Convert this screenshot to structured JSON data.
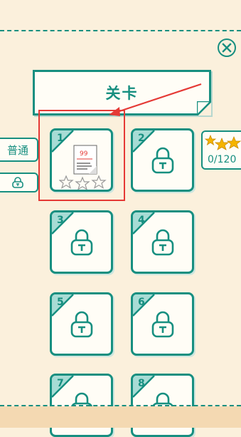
{
  "header": {
    "title": "关卡"
  },
  "tabs": [
    {
      "label": "普通",
      "active": true
    },
    {
      "label": "",
      "locked": true
    }
  ],
  "stars_counter": {
    "value": "0/120"
  },
  "levels": [
    {
      "number": "1",
      "locked": false,
      "best_score": "99",
      "stars": 0
    },
    {
      "number": "2",
      "locked": true
    },
    {
      "number": "3",
      "locked": true
    },
    {
      "number": "4",
      "locked": true
    },
    {
      "number": "5",
      "locked": true
    },
    {
      "number": "6",
      "locked": true
    },
    {
      "number": "7",
      "locked": true
    },
    {
      "number": "8",
      "locked": true
    }
  ],
  "icons": {
    "close": "close-icon",
    "lock": "lock-icon",
    "star": "star-icon",
    "document": "document-icon"
  },
  "colors": {
    "primary": "#178f80",
    "corner_accent": "#a7dcd5",
    "background": "#fbf0dc",
    "highlight": "#e53935",
    "star_gold": "#f5b400"
  }
}
